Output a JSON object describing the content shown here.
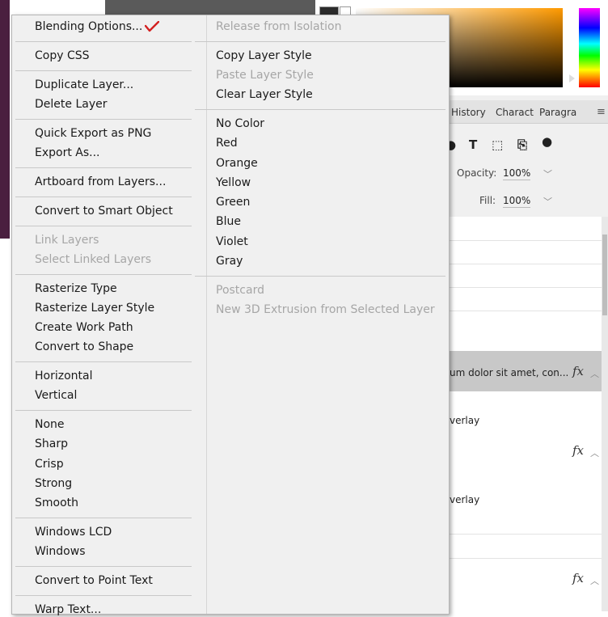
{
  "left_menu": {
    "blending_options": "Blending Options...",
    "copy_css": "Copy CSS",
    "duplicate_layer": "Duplicate Layer...",
    "delete_layer": "Delete Layer",
    "quick_export": "Quick Export as PNG",
    "export_as": "Export As...",
    "artboard_from_layers": "Artboard from Layers...",
    "convert_smart_object": "Convert to Smart Object",
    "link_layers": "Link Layers",
    "select_linked_layers": "Select Linked Layers",
    "rasterize_type": "Rasterize Type",
    "rasterize_layer_style": "Rasterize Layer Style",
    "create_work_path": "Create Work Path",
    "convert_to_shape": "Convert to Shape",
    "horizontal": "Horizontal",
    "vertical": "Vertical",
    "none": "None",
    "sharp": "Sharp",
    "crisp": "Crisp",
    "strong": "Strong",
    "smooth": "Smooth",
    "windows_lcd": "Windows LCD",
    "windows": "Windows",
    "convert_point_text": "Convert to Point Text",
    "warp_text": "Warp Text..."
  },
  "right_menu": {
    "release_isolation": "Release from Isolation",
    "copy_layer_style": "Copy Layer Style",
    "paste_layer_style": "Paste Layer Style",
    "clear_layer_style": "Clear Layer Style",
    "no_color": "No Color",
    "red": "Red",
    "orange": "Orange",
    "yellow": "Yellow",
    "green": "Green",
    "blue": "Blue",
    "violet": "Violet",
    "gray": "Gray",
    "postcard": "Postcard",
    "new_3d_extrusion": "New 3D Extrusion from Selected Layer"
  },
  "panel": {
    "tab_history": "History",
    "tab_character": "Charact",
    "tab_paragraph": "Paragra",
    "opacity_label": "Opacity:",
    "opacity_value": "100%",
    "fill_label": "Fill:",
    "fill_value": "100%",
    "layer_text": "um dolor sit amet, con...",
    "overlay_1": "verlay",
    "overlay_2": "verlay",
    "fx": "fx"
  },
  "colors": {
    "check_mark": "#d32020",
    "menu_bg": "#f0f0f0",
    "disabled_text": "#a6a6a6"
  }
}
